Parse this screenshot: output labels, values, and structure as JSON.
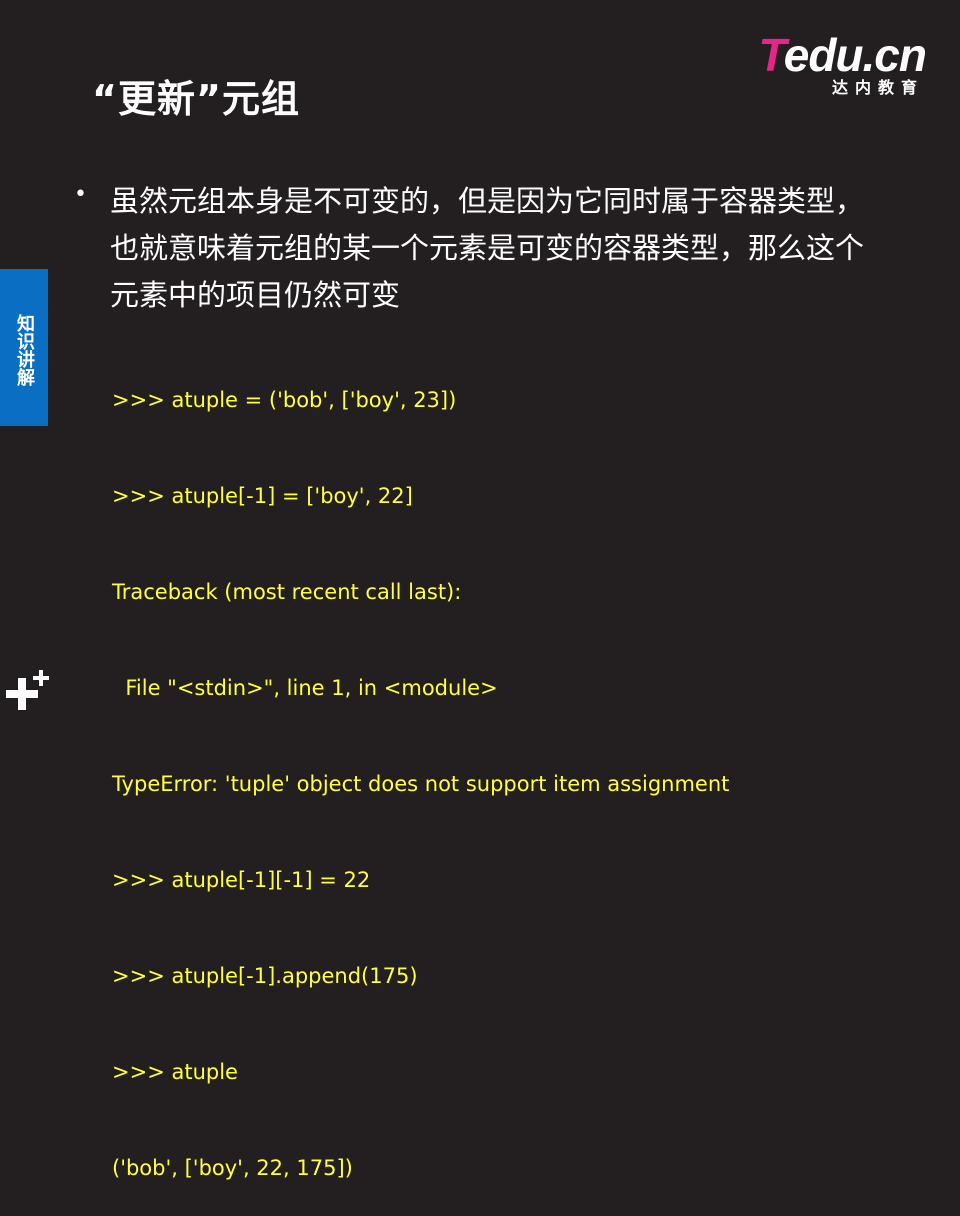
{
  "slide": {
    "title": "“更新”元组",
    "side_tab": "知识讲解",
    "logo": {
      "brand_t": "T",
      "brand_rest": "edu.cn",
      "subtitle": "达内教育"
    },
    "bullet": "•",
    "bullet_text": "虽然元组本身是不可变的，但是因为它同时属于容器类型，也就意味着元组的某一个元素是可变的容器类型，那么这个元素中的项目仍然可变",
    "code_lines": [
      ">>> atuple = ('bob', ['boy', 23])",
      ">>> atuple[-1] = ['boy', 22]",
      "Traceback (most recent call last):",
      "  File \"<stdin>\", line 1, in <module>",
      "TypeError: 'tuple' object does not support item assignment",
      ">>> atuple[-1][-1] = 22",
      ">>> atuple[-1].append(175)",
      ">>> atuple",
      "('bob', ['boy', 22, 175])"
    ]
  },
  "colors": {
    "background": "#231f20",
    "code": "#ffff3b",
    "side_tab": "#0a6fc2",
    "logo_accent": "#e8238a"
  }
}
